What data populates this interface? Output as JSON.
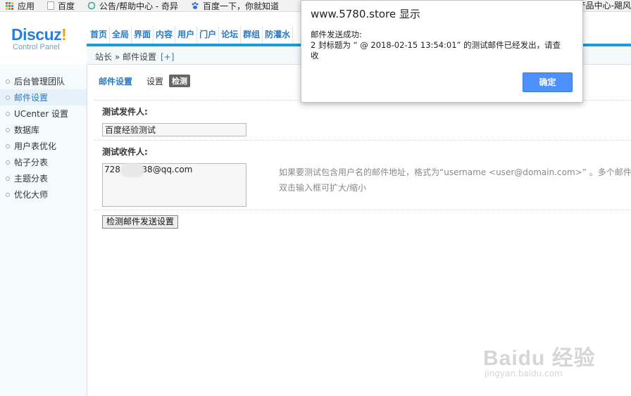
{
  "bookmarks": {
    "apps": "应用",
    "baidu": "百度",
    "notice": "公告/帮助中心 - 奇异",
    "baidu_search": "百度一下，你就知道",
    "right_text": "产品中心-飓风"
  },
  "logo": {
    "main": "Discuz",
    "bang": "!",
    "sub": "Control Panel"
  },
  "topnav": [
    "首页",
    "全局",
    "界面",
    "内容",
    "用户",
    "门户",
    "论坛",
    "群组",
    "防灌水"
  ],
  "breadcrumb": {
    "text": "站长 » 邮件设置",
    "plus": "[+]"
  },
  "sidebar": {
    "items": [
      "后台管理团队",
      "邮件设置",
      "UCenter 设置",
      "数据库",
      "用户表优化",
      "帖子分表",
      "主题分表",
      "优化大师"
    ],
    "active_index": 1
  },
  "tabs": {
    "mail_settings": "邮件设置",
    "settings": "设置",
    "test": "检测"
  },
  "form": {
    "sender_label": "测试发件人:",
    "sender_value": "百度经验测试",
    "recipient_label": "测试收件人:",
    "recipient_value": "728      038@qq.com",
    "hint_line1": "如果要测试包含用户名的邮件地址，格式为“username <user@domain.com>” 。多个邮件",
    "hint_line2": "双击输入框可扩大/缩小",
    "submit_label": "检测邮件发送设置"
  },
  "dialog": {
    "title": "www.5780.store 显示",
    "line1": "邮件发送成功:",
    "line2": "2 封标题为 “ @ 2018-02-15 13:54:01” 的测试邮件已经发出，请查",
    "line3": "收",
    "ok_label": "确定"
  },
  "watermark": {
    "main": "Baidu 经验",
    "sub": "jingyan.baidu.com"
  },
  "colors": {
    "accent": "#2b79c1",
    "nav_bar": "#1f9ad6",
    "ok_button": "#4d90fe"
  }
}
